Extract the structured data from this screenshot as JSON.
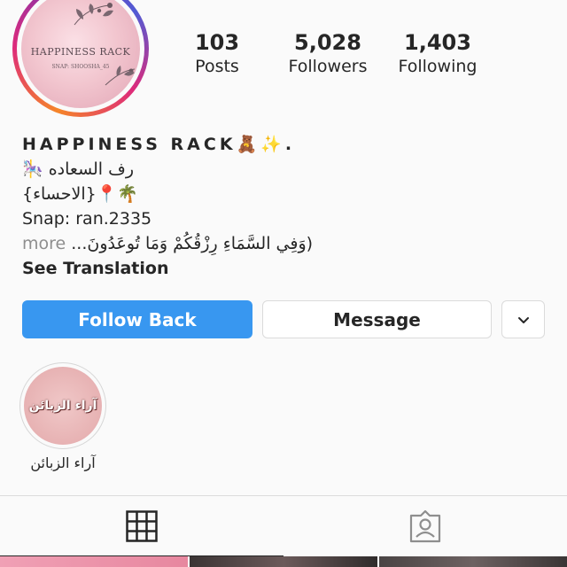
{
  "profile": {
    "avatar": {
      "logo_title": "HAPPINESS RACK",
      "logo_sub": "SNAP: SHOOSHA_45"
    },
    "stats": [
      {
        "value": "103",
        "label": "Posts"
      },
      {
        "value": "5,028",
        "label": "Followers"
      },
      {
        "value": "1,403",
        "label": "Following"
      }
    ],
    "bio": {
      "name": "HAPPINESS RACK🧸✨.",
      "line1": "رف السعاده 🎠",
      "line2": "🌴📍{الاحساء}",
      "line3": "Snap: ran.2335",
      "line4_more": "more",
      "line4_text": "(وَفِي السَّمَاءِ رِزْقُكُمْ وَمَا تُوعَدُونَ...",
      "see_translation": "See Translation"
    }
  },
  "actions": {
    "follow_back": "Follow Back",
    "message": "Message",
    "dropdown_icon": "chevron-down-icon"
  },
  "highlights": [
    {
      "cover_text": "آراء الزبائن",
      "label": "آراء الزبائن"
    }
  ],
  "tabs": [
    {
      "icon": "grid-icon",
      "active": true
    },
    {
      "icon": "tagged-person-icon",
      "active": false
    }
  ],
  "colors": {
    "accent": "#3897f0",
    "text": "#262626",
    "muted": "#8e8e8e",
    "border": "#dbdbdb"
  }
}
